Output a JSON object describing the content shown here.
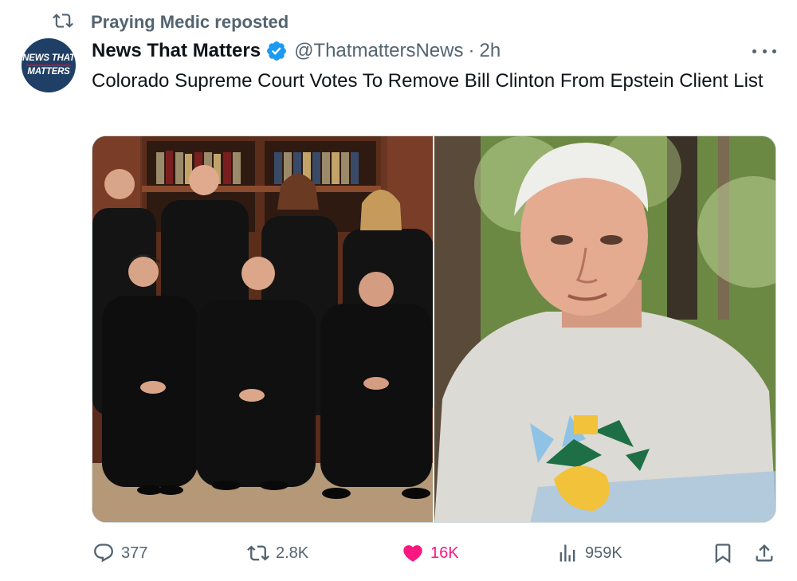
{
  "repost": {
    "label": "Praying Medic reposted"
  },
  "author": {
    "name": "News That Matters",
    "handle": "@ThatmattersNews",
    "separator": "·",
    "time": "2h",
    "avatar_line1": "NEWS THAT",
    "avatar_line2": "MATTERS"
  },
  "tweet": {
    "text": "Colorado Supreme Court Votes To Remove Bill Clinton From Epstein Client List"
  },
  "actions": {
    "replies": "377",
    "reposts": "2.8K",
    "likes": "16K",
    "views": "959K"
  },
  "colors": {
    "verified": "#1d9bf0",
    "like": "#f91880",
    "muted": "#536471",
    "text": "#0f1419",
    "avatar_bg": "#1f3f66"
  },
  "icons": {
    "repost": "repost-icon",
    "verified": "verified-badge-icon",
    "more": "more-icon",
    "reply": "reply-icon",
    "like": "heart-icon",
    "views": "views-icon",
    "bookmark": "bookmark-icon",
    "share": "share-icon"
  }
}
